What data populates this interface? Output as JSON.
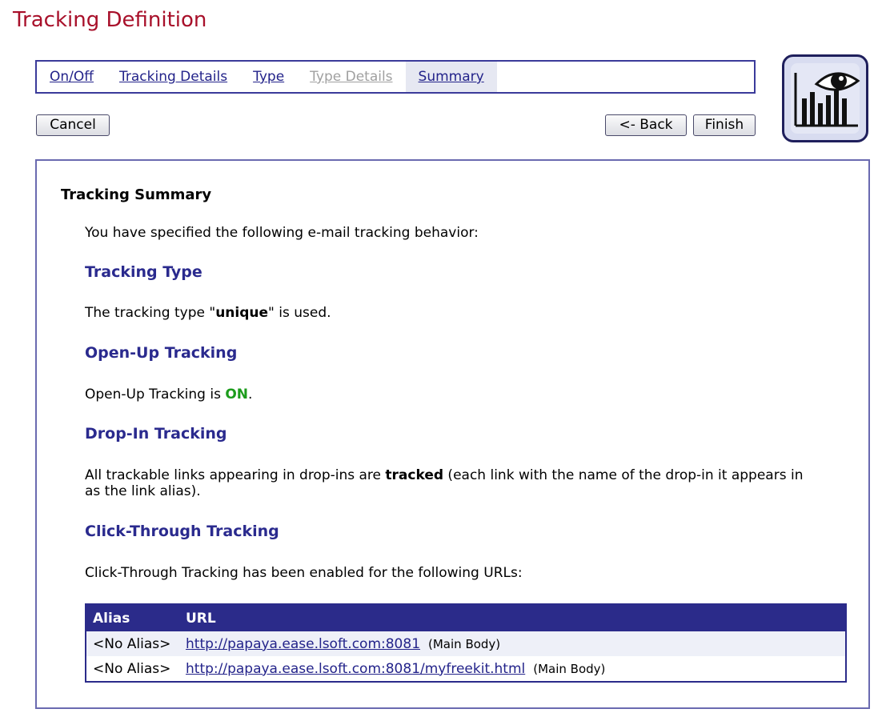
{
  "page": {
    "title": "Tracking Definition"
  },
  "wizard": {
    "steps": [
      {
        "label": "On/Off",
        "state": "enabled"
      },
      {
        "label": "Tracking Details",
        "state": "enabled"
      },
      {
        "label": "Type",
        "state": "enabled"
      },
      {
        "label": "Type Details",
        "state": "disabled"
      },
      {
        "label": "Summary",
        "state": "active"
      }
    ]
  },
  "buttons": {
    "cancel": "Cancel",
    "back": "<- Back",
    "finish": "Finish"
  },
  "logo": {
    "icon": "tracking-eye-chart-icon"
  },
  "summary": {
    "heading": "Tracking Summary",
    "intro": "You have specified the following e-mail tracking behavior:",
    "tracking_type": {
      "heading": "Tracking Type",
      "text_before": "The tracking type \"",
      "value": "unique",
      "text_after": "\" is used."
    },
    "open_up": {
      "heading": "Open-Up Tracking",
      "text_before": "Open-Up Tracking is ",
      "value": "ON",
      "text_after": "."
    },
    "drop_in": {
      "heading": "Drop-In Tracking",
      "text_before": "All trackable links appearing in drop-ins are ",
      "value": "tracked",
      "text_after": " (each link with the name of the drop-in it appears in as the link alias)."
    },
    "click_through": {
      "heading": "Click-Through Tracking",
      "text": "Click-Through Tracking has been enabled for the following URLs:",
      "table": {
        "headers": {
          "alias": "Alias",
          "url": "URL"
        },
        "rows": [
          {
            "alias": "<No Alias>",
            "url": "http://papaya.ease.lsoft.com:8081",
            "note": "(Main Body)"
          },
          {
            "alias": "<No Alias>",
            "url": "http://papaya.ease.lsoft.com:8081/myfreekit.html",
            "note": "(Main Body)"
          }
        ]
      }
    }
  },
  "colors": {
    "title": "#a8102a",
    "heading_blue": "#2a2a8e",
    "table_header": "#2b2b8a",
    "on_green": "#1c9c1c"
  }
}
